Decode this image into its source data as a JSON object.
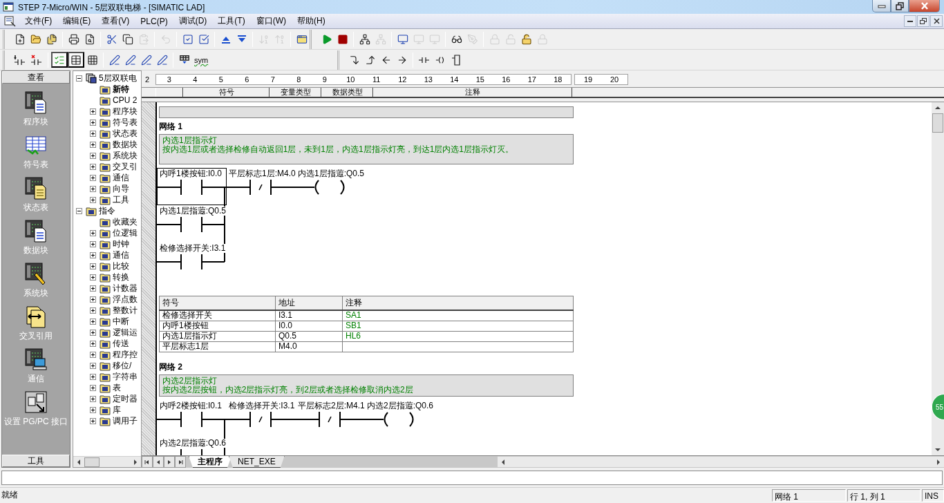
{
  "window": {
    "title": "STEP 7-Micro/WIN - 5层双联电梯 - [SIMATIC LAD]"
  },
  "menu": [
    "文件(F)",
    "编辑(E)",
    "查看(V)",
    "PLC(P)",
    "调试(D)",
    "工具(T)",
    "窗口(W)",
    "帮助(H)"
  ],
  "toolbar_1": {
    "sections": [
      {
        "groups": [
          [
            {
              "disabled": false
            },
            {
              "disabled": false
            },
            {
              "disabled": false
            }
          ],
          [
            {
              "disabled": false
            },
            {
              "disabled": false
            }
          ],
          [
            {
              "disabled": false
            },
            {
              "disabled": false
            },
            {
              "disabled": true
            }
          ],
          [
            {
              "disabled": true
            }
          ],
          [
            {
              "disabled": false
            },
            {
              "disabled": false
            }
          ],
          [
            {
              "disabled": false
            },
            {
              "disabled": false
            }
          ],
          [
            {
              "disabled": true
            },
            {
              "disabled": true
            }
          ],
          [
            {
              "disabled": false
            }
          ]
        ]
      },
      {
        "groups": [
          [
            {
              "disabled": false
            },
            {
              "disabled": false
            }
          ],
          [
            {
              "disabled": false
            },
            {
              "disabled": true
            }
          ],
          [
            {
              "disabled": false
            },
            {
              "disabled": true
            },
            {
              "disabled": true
            }
          ],
          [
            {
              "disabled": false
            },
            {
              "disabled": true
            }
          ],
          [
            {
              "disabled": true
            },
            {
              "disabled": true
            },
            {
              "disabled": false
            },
            {
              "disabled": true
            }
          ]
        ]
      }
    ]
  },
  "toolbar_2": {
    "sections": [
      {
        "groups": [
          [
            {
              "disabled": false
            },
            {
              "disabled": false
            }
          ],
          [
            {
              "disabled": false,
              "selected": true
            },
            {
              "disabled": false,
              "selected": true
            },
            {
              "disabled": false,
              "selected": false
            }
          ],
          [
            {
              "disabled": false
            },
            {
              "disabled": false
            },
            {
              "disabled": false
            },
            {
              "disabled": false
            }
          ],
          [
            {
              "disabled": false
            },
            {
              "disabled": false,
              "label": "sym"
            }
          ]
        ]
      },
      {
        "groups": [
          [
            {
              "disabled": false
            },
            {
              "disabled": false
            },
            {
              "disabled": false
            },
            {
              "disabled": false
            }
          ],
          [
            {
              "disabled": false
            },
            {
              "disabled": false
            },
            {
              "disabled": false
            }
          ]
        ]
      }
    ]
  },
  "navigation_bar": {
    "header": "查看",
    "items": [
      "程序块",
      "符号表",
      "状态表",
      "数据块",
      "系统块",
      "交叉引用",
      "通信",
      "设置 PG/PC 接口"
    ],
    "footer": "工具"
  },
  "tree": [
    {
      "label": "5层双联电",
      "kind": "node",
      "expanded": true,
      "children": [
        {
          "label": "新特",
          "kind": "leaf",
          "bold": true
        },
        {
          "label": "CPU 2",
          "kind": "leaf"
        },
        {
          "label": "程序块",
          "kind": "node",
          "expanded": false
        },
        {
          "label": "符号表",
          "kind": "node",
          "expanded": false
        },
        {
          "label": "状态表",
          "kind": "node",
          "expanded": false
        },
        {
          "label": "数据块",
          "kind": "node",
          "expanded": false
        },
        {
          "label": "系统块",
          "kind": "node",
          "expanded": false
        },
        {
          "label": "交叉引",
          "kind": "node",
          "expanded": false
        },
        {
          "label": "通信",
          "kind": "node",
          "expanded": false
        },
        {
          "label": "向导",
          "kind": "node",
          "expanded": false
        },
        {
          "label": "工具",
          "kind": "node",
          "expanded": false
        }
      ]
    },
    {
      "label": "指令",
      "kind": "node",
      "expanded": true,
      "children": [
        {
          "label": "收藏夹",
          "kind": "leaf"
        },
        {
          "label": "位逻辑",
          "kind": "node",
          "expanded": false
        },
        {
          "label": "时钟",
          "kind": "node",
          "expanded": false
        },
        {
          "label": "通信",
          "kind": "node",
          "expanded": false
        },
        {
          "label": "比较",
          "kind": "node",
          "expanded": false
        },
        {
          "label": "转换",
          "kind": "node",
          "expanded": false
        },
        {
          "label": "计数器",
          "kind": "node",
          "expanded": false
        },
        {
          "label": "浮点数",
          "kind": "node",
          "expanded": false
        },
        {
          "label": "整数计",
          "kind": "node",
          "expanded": false
        },
        {
          "label": "中断",
          "kind": "node",
          "expanded": false
        },
        {
          "label": "逻辑运",
          "kind": "node",
          "expanded": false
        },
        {
          "label": "传送",
          "kind": "node",
          "expanded": false
        },
        {
          "label": "程序控",
          "kind": "node",
          "expanded": false
        },
        {
          "label": "移位/",
          "kind": "node",
          "expanded": false
        },
        {
          "label": "字符串",
          "kind": "node",
          "expanded": false
        },
        {
          "label": "表",
          "kind": "node",
          "expanded": false
        },
        {
          "label": "定时器",
          "kind": "node",
          "expanded": false
        },
        {
          "label": "库",
          "kind": "node",
          "expanded": false
        },
        {
          "label": "调用子",
          "kind": "node",
          "expanded": false
        }
      ]
    }
  ],
  "ruler": {
    "ticks": [
      "2",
      "3",
      "4",
      "5",
      "6",
      "7",
      "8",
      "9",
      "10",
      "11",
      "12",
      "13",
      "14",
      "15",
      "16",
      "17",
      "18"
    ],
    "extra_ticks": [
      "19",
      "20"
    ]
  },
  "variable_table": {
    "columns": [
      "符号",
      "变量类型",
      "数据类型",
      "注释"
    ]
  },
  "networks": [
    {
      "title": "网络 1",
      "comment": [
        "内选1层指示灯",
        "按内选1层或者选择检修自动返回1层，未到1层，内选1层指示灯亮，到达1层内选1层指示灯灭。"
      ],
      "ladder": {
        "elements": [
          {
            "kind": "no_contact",
            "label": "内呼1楼按钮:I0.0",
            "selected": true
          },
          {
            "kind": "nc_contact",
            "label": "平层标志1层:M4.0",
            "selected": false
          },
          {
            "kind": "coil",
            "label": "内选1层指蕸:Q0.5",
            "selected": false
          }
        ],
        "branches": [
          {
            "kind": "no_contact",
            "label": "内选1层指蕸:Q0.5",
            "selected": false
          },
          {
            "kind": "no_contact",
            "label": "检修选择开关:I3.1",
            "selected": false
          }
        ]
      },
      "symbol_table": {
        "columns": [
          "符号",
          "地址",
          "注释"
        ],
        "rows": [
          [
            "检修选择开关",
            "I3.1",
            "SA1"
          ],
          [
            "内呼1楼按钮",
            "I0.0",
            "SB1"
          ],
          [
            "内选1层指示灯",
            "Q0.5",
            "HL6"
          ],
          [
            "平层标志1层",
            "M4.0"
          ]
        ]
      }
    },
    {
      "title": "网络 2",
      "comment": [
        "内选2层指示灯",
        "按内选2层按钮，内选2层指示灯亮，到2层或者选择检修取消内选2层"
      ],
      "ladder": {
        "elements": [
          {
            "kind": "no_contact",
            "label": "内呼2楼按钮:I0.1",
            "selected": false
          },
          {
            "kind": "nc_contact",
            "label": "检修选择开关:I3.1",
            "selected": false
          },
          {
            "kind": "nc_contact",
            "label": "平层标志2层:M4.1",
            "selected": false
          },
          {
            "kind": "coil",
            "label": "内选2层指蕸:Q0.6",
            "selected": false
          }
        ],
        "branches": [
          {
            "kind": "no_contact",
            "label": "内选2层指蕸:Q0.6",
            "selected": false
          }
        ]
      }
    }
  ],
  "badge": "55",
  "tabs": [
    {
      "label": "主程序",
      "selected": true
    },
    {
      "label": "NET_EXE",
      "selected": false
    }
  ],
  "status_bar": {
    "message": "就绪",
    "network": "网络 1",
    "position": "行 1, 列 1",
    "mode": "INS"
  }
}
